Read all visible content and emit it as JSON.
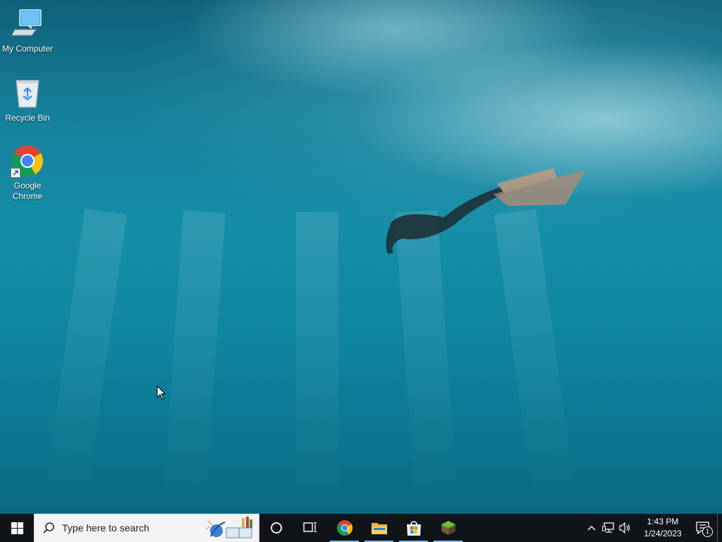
{
  "desktop": {
    "icons": [
      {
        "label": "My Computer"
      },
      {
        "label": "Recycle Bin"
      },
      {
        "label": "Google Chrome"
      }
    ]
  },
  "taskbar": {
    "search_placeholder": "Type here to search",
    "pinned": [
      {
        "name": "Google Chrome",
        "icon": "chrome-icon",
        "active": true
      },
      {
        "name": "File Explorer",
        "icon": "folder-icon",
        "active": true
      },
      {
        "name": "Microsoft Store",
        "icon": "store-icon",
        "active": true
      },
      {
        "name": "Minecraft",
        "icon": "minecraft-icon",
        "active": true
      }
    ]
  },
  "tray": {
    "time": "1:43 PM",
    "date": "1/24/2023",
    "notification_count": "1"
  },
  "colors": {
    "taskbar": "#101418",
    "accent": "#76b9ed"
  }
}
